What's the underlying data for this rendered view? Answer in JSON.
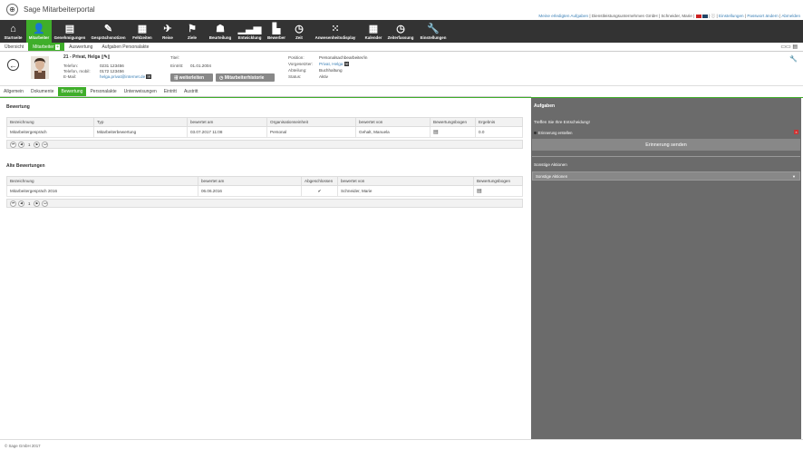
{
  "app": {
    "title": "Sage Mitarbeiterportal",
    "logo_icon": "globe-icon"
  },
  "toplinks": {
    "tasks": "Meine erledigten Aufgaben",
    "company": "Dienstleistungsunternehmen GmbH",
    "user": "Schneider, Marie",
    "settings": "Einstellungen",
    "password": "Passwort ändern",
    "logout": "Abmelden"
  },
  "nav": [
    {
      "label": "Startseite",
      "icon": "home-icon",
      "glyph": "⌂"
    },
    {
      "label": "Mitarbeiter",
      "icon": "users-icon",
      "glyph": "👤"
    },
    {
      "label": "Genehmigungen",
      "icon": "approvals-icon",
      "glyph": "▤"
    },
    {
      "label": "Gesprächsnotizen",
      "icon": "notes-icon",
      "glyph": "✎"
    },
    {
      "label": "Fehlzeiten",
      "icon": "calendar-icon",
      "glyph": "▦"
    },
    {
      "label": "Reise",
      "icon": "plane-icon",
      "glyph": "✈"
    },
    {
      "label": "Ziele",
      "icon": "target-icon",
      "glyph": "⚑"
    },
    {
      "label": "Beurteilung",
      "icon": "evaluation-icon",
      "glyph": "☗"
    },
    {
      "label": "Entwicklung",
      "icon": "chart-icon",
      "glyph": "▁▃▅"
    },
    {
      "label": "Bewerber",
      "icon": "applicant-icon",
      "glyph": "▙"
    },
    {
      "label": "Zeit",
      "icon": "clock-icon",
      "glyph": "◷"
    },
    {
      "label": "Anwesenheitsdisplay",
      "icon": "grid-icon",
      "glyph": "⁙"
    },
    {
      "label": "Kalender",
      "icon": "calendar2-icon",
      "glyph": "▦"
    },
    {
      "label": "Zeiterfassung",
      "icon": "time-entry-icon",
      "glyph": "◷"
    },
    {
      "label": "Einstellungen",
      "icon": "wrench-icon",
      "glyph": "🔧"
    }
  ],
  "subnav": [
    "Übersicht",
    "Mitarbeiter",
    "Auswertung",
    "Aufgaben Personalakte"
  ],
  "profile": {
    "name": "21 - Privat, Helga",
    "phone_label": "Telefon:",
    "phone": "0231 123456",
    "mobile_label": "Telefon, mobil:",
    "mobile": "0172 123456",
    "email_label": "E-Mail:",
    "email": "helga.privat@internet.de",
    "title_label": "Titel:",
    "title": "",
    "entry_label": "Eintritt:",
    "entry": "01.01.2004",
    "position_label": "Position:",
    "position": "Personalsachbearbeiter/in",
    "manager_label": "Vorgesetzter:",
    "manager": "Privat, Helga",
    "department_label": "Abteilung:",
    "department": "Buchhaltung",
    "status_label": "Status:",
    "status": "Aktiv",
    "forward_button": "weiterleiten",
    "history_button": "Mitarbeiterhistorie"
  },
  "tabs": [
    "Allgemein",
    "Dokumente",
    "Bewertung",
    "Personalakte",
    "Unterweisungen",
    "Eintritt",
    "Austritt"
  ],
  "evaluation": {
    "title": "Bewertung",
    "columns": [
      "Bezeichnung",
      "Typ",
      "bewertet am",
      "Organisationseinheit",
      "bewertet von",
      "Bewertungsbogen",
      "Ergebnis"
    ],
    "rows": [
      [
        "Mitarbeitergespräch",
        "Mitarbeiterbewertung",
        "03.07.2017 11:08",
        "Personal",
        "Gehalt, Manuela",
        "",
        "0.0"
      ]
    ],
    "page": "1"
  },
  "old_evaluations": {
    "title": "Alte Bewertungen",
    "columns": [
      "Bezeichnung",
      "bewertet am",
      "Abgeschlossen",
      "bewertet von",
      "Bewertungsbogen"
    ],
    "rows": [
      [
        "Mitarbeitergespräch 2016",
        "06.06.2016",
        "✔",
        "Schneider, Marie",
        ""
      ]
    ],
    "page": "1"
  },
  "tasks_panel": {
    "title": "Aufgaben",
    "question": "Treffen Sie Ihre Entscheidung!",
    "option": "Erinnerung erstellen",
    "send_button": "Erinnerung senden",
    "other_title": "Sonstige Aktionen",
    "other_select": "Sonstige Aktionen"
  },
  "footer": "© Sage GmbH 2017"
}
